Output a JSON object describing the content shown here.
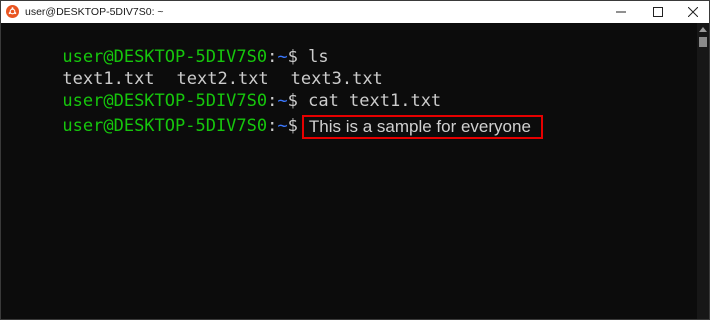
{
  "window": {
    "title": "user@DESKTOP-5DIV7S0: ~",
    "icon": "ubuntu-icon"
  },
  "controls": {
    "minimize_icon": "minimize-icon",
    "maximize_icon": "maximize-icon",
    "close_icon": "close-icon"
  },
  "prompt": {
    "user_host": "user@DESKTOP-5DIV7S0",
    "colon": ":",
    "path": "~",
    "dollar": "$"
  },
  "lines": [
    {
      "command": " ls"
    },
    {
      "files": [
        "text1.txt",
        "text2.txt",
        "text3.txt"
      ]
    },
    {
      "command": " cat text1.txt"
    },
    {
      "output": "This is a sample for everyone"
    }
  ],
  "colors": {
    "background": "#0c0c0c",
    "text": "#cccccc",
    "prompt_user": "#16c60c",
    "prompt_path": "#3b78ff",
    "highlight_border": "#e60000"
  }
}
